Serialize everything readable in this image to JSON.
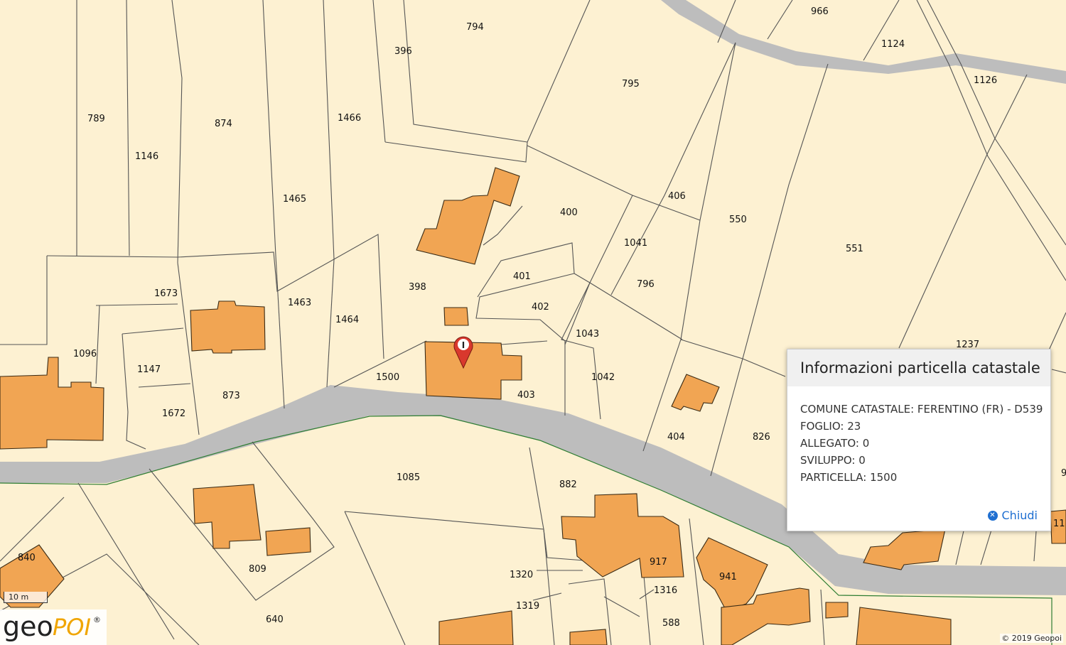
{
  "parcel_labels": {
    "p794": "794",
    "p966": "966",
    "p396": "396",
    "p1124": "1124",
    "p1126": "1126",
    "p789": "789",
    "p874": "874",
    "p1466": "1466",
    "p795": "795",
    "p1146": "1146",
    "p406": "406",
    "p550": "550",
    "p400": "400",
    "p1465": "1465",
    "p1041": "1041",
    "p551": "551",
    "p1673": "1673",
    "p401": "401",
    "p796": "796",
    "p1463": "1463",
    "p398": "398",
    "p402": "402",
    "p1464": "1464",
    "p1043": "1043",
    "p1096": "1096",
    "p1237": "1237",
    "p1147": "1147",
    "p1500": "1500",
    "p1042": "1042",
    "p873": "873",
    "p403": "403",
    "p1672": "1672",
    "p404": "404",
    "p826": "826",
    "p1085": "1085",
    "p882": "882",
    "p840": "840",
    "p809": "809",
    "p917": "917",
    "p941": "941",
    "p1320": "1320",
    "p1316": "1316",
    "p1319": "1319",
    "p640": "640",
    "p588": "588",
    "p9": "9",
    "p11": "11"
  },
  "popup": {
    "title": "Informazioni particella catastale",
    "rows": [
      "COMUNE CATASTALE: FERENTINO (FR) - D539",
      "FOGLIO: 23",
      "ALLEGATO: 0",
      "SVILUPPO: 0",
      "PARTICELLA: 1500"
    ],
    "close_label": "Chiudi"
  },
  "scale_label": "10 m",
  "logo": {
    "geo": "geo",
    "poi": "POI",
    "reg": "®"
  },
  "copyright": "© 2019 Geopoi",
  "marker_glyph": "I",
  "colors": {
    "background": "#fdf1d2",
    "building": "#f1a553",
    "road": "#bdbdbd",
    "accent": "#1f6fd1"
  }
}
